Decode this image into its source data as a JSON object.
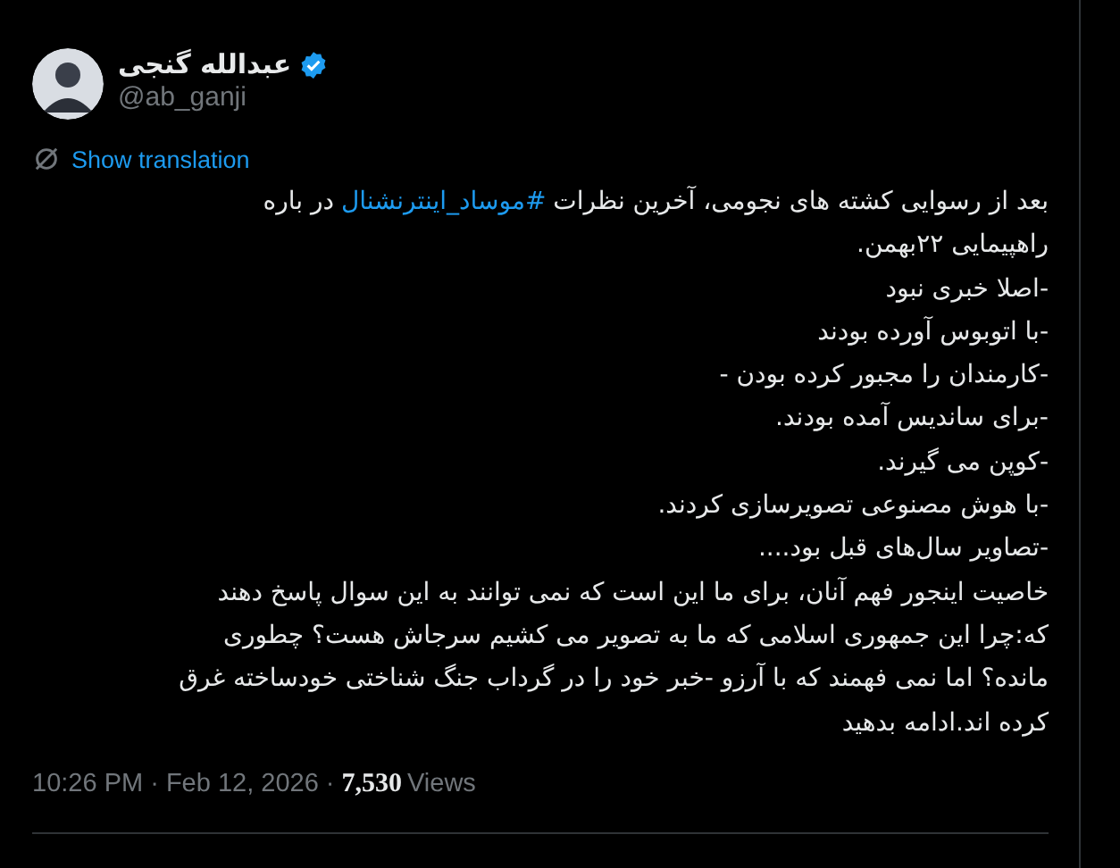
{
  "author": {
    "name": "عبدالله گنجی",
    "verified": true,
    "handle": "@ab_ganji"
  },
  "translate_link": "Show translation",
  "body": {
    "first_line": {
      "before": "بعد از رسوایی کشته های نجومی، آخرین نظرات",
      "hashtag": "#موساد_اینترنشنال",
      "after": "در باره"
    },
    "lines": [
      "راهپیمایی ۲۲بهمن.",
      "-اصلا خبری نبود",
      "-با اتوبوس آورده بودند",
      "-کارمندان را مجبور کرده بودن -",
      "-برای ساندیس آمده بودند.",
      "-کوپن می گیرند.",
      "-با هوش مصنوعی تصویرسازی کردند.",
      "-تصاویر سال‌های قبل بود....",
      "خاصیت اینجور فهم آنان، برای ما این است که نمی توانند به این سوال پاسخ دهند",
      "که:چرا این جمهوری اسلامی که ما به تصویر می کشیم سرجاش هست؟  چطوری",
      "مانده؟ اما نمی فهمند که با آرزو -خبر خود را در گرداب جنگ شناختی خودساخته غرق",
      "کرده اند.ادامه بدهید"
    ]
  },
  "meta": {
    "timestamp": "10:26 PM · Feb 12, 2026 ·",
    "views_count": "7,530",
    "views_label": "Views"
  }
}
